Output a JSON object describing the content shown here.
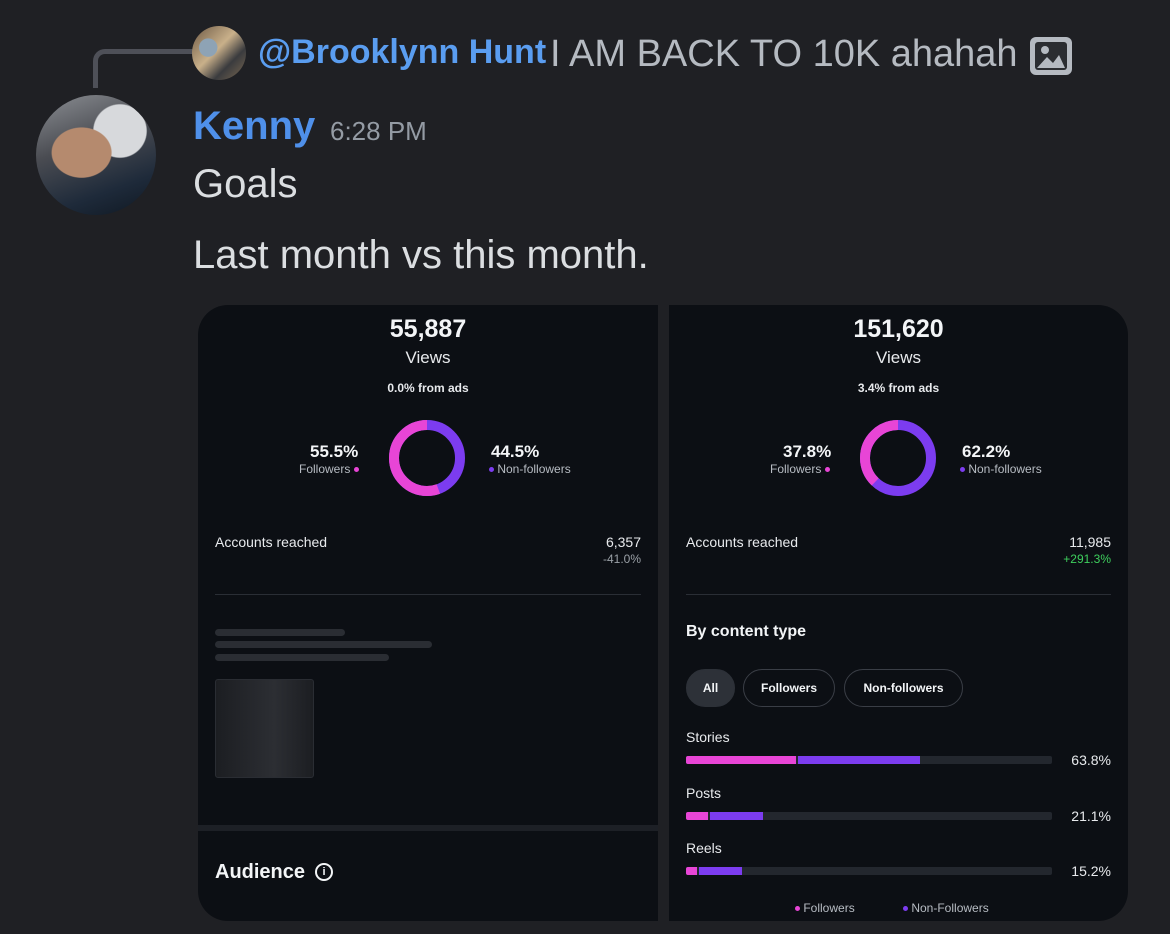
{
  "reply": {
    "username": "@Brooklynn Hunt",
    "text": "I AM BACK TO 10K ahahah"
  },
  "message": {
    "author": "Kenny",
    "time": "6:28 PM",
    "lines": [
      "Goals",
      "Last month vs this month."
    ]
  },
  "icons": {
    "reply_image": "image-icon",
    "info": "info-icon"
  },
  "colors": {
    "followers": "#e845d6",
    "non_followers": "#7c3cf0",
    "positive": "#3ecf5d",
    "negative": "#9aa0a6"
  },
  "left_card": {
    "views_total": "55,887",
    "views_label": "Views",
    "ads_text": "0.0% from ads",
    "followers_pct": "55.5%",
    "followers_label": "Followers",
    "followers_fraction": 0.555,
    "non_followers_pct": "44.5%",
    "non_followers_label": "Non-followers",
    "accounts_reached_label": "Accounts reached",
    "accounts_reached_value": "6,357",
    "accounts_reached_change": "-41.0%",
    "audience_title": "Audience",
    "info_glyph": "i"
  },
  "right_card": {
    "views_total": "151,620",
    "views_label": "Views",
    "ads_text": "3.4% from ads",
    "followers_pct": "37.8%",
    "followers_label": "Followers",
    "followers_fraction": 0.378,
    "non_followers_pct": "62.2%",
    "non_followers_label": "Non-followers",
    "accounts_reached_label": "Accounts reached",
    "accounts_reached_value": "11,985",
    "accounts_reached_change": "+291.3%",
    "by_content_type_title": "By content type",
    "filters": [
      "All",
      "Followers",
      "Non-followers"
    ],
    "selected_filter": "All",
    "content_types": [
      {
        "label": "Stories",
        "total_pct": "63.8%",
        "total": 0.638,
        "followers": 0.3
      },
      {
        "label": "Posts",
        "total_pct": "21.1%",
        "total": 0.211,
        "followers": 0.06
      },
      {
        "label": "Reels",
        "total_pct": "15.2%",
        "total": 0.152,
        "followers": 0.03
      }
    ],
    "legend": [
      "Followers",
      "Non-Followers"
    ]
  }
}
